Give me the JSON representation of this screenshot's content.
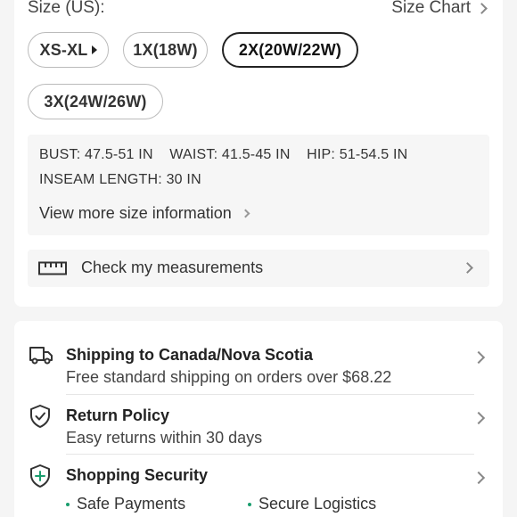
{
  "size": {
    "label": "Size (US):",
    "chart_link": "Size Chart",
    "options": [
      {
        "label": "XS-XL",
        "has_caret": true,
        "selected": false
      },
      {
        "label": "1X(18W)",
        "selected": false
      },
      {
        "label": "2X(20W/22W)",
        "selected": true
      },
      {
        "label": "3X(24W/26W)",
        "selected": false
      }
    ]
  },
  "size_info": {
    "line1": "BUST: 47.5-51 IN    WAIST: 41.5-45 IN    HIP: 51-54.5 IN",
    "line2": "INSEAM LENGTH: 30 IN",
    "more_link": "View more size information"
  },
  "measurements": {
    "label": "Check my measurements",
    "icon": "ruler-icon"
  },
  "services": {
    "shipping": {
      "title": "Shipping to Canada/Nova Scotia",
      "subtitle": "Free standard shipping on orders over $68.22",
      "icon": "truck-icon"
    },
    "returns": {
      "title": "Return Policy",
      "subtitle": "Easy returns within 30 days",
      "icon": "shield-check-icon"
    },
    "security": {
      "title": "Shopping Security",
      "icon": "shield-plus-icon",
      "items": [
        "Safe Payments",
        "Secure Logistics"
      ]
    }
  },
  "colors": {
    "accent_dot": "#1a9e6e",
    "selected_border": "#222222"
  }
}
